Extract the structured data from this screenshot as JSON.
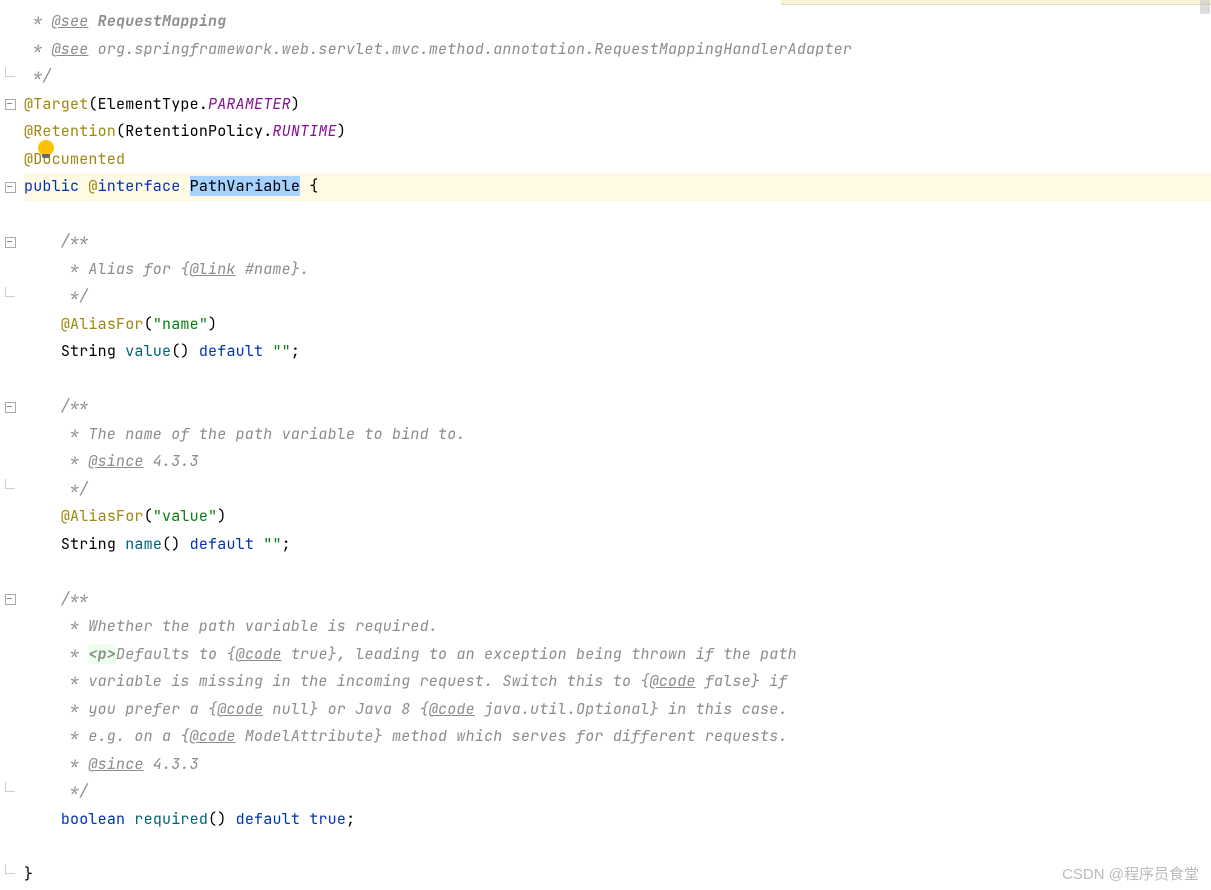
{
  "watermark": "CSDN @程序员食堂",
  "code": {
    "line1": {
      "prefix": " * ",
      "tag": "@see",
      "link": "RequestMapping"
    },
    "line2": {
      "prefix": " * ",
      "tag": "@see",
      "text": "org.springframework.web.servlet.mvc.method.annotation.RequestMappingHandlerAdapter"
    },
    "line3": {
      "text": " */"
    },
    "line4": {
      "anno": "@Target",
      "lparen": "(",
      "type": "ElementType.",
      "field": "PARAMETER",
      "rparen": ")"
    },
    "line5": {
      "anno": "@Retention",
      "lparen": "(",
      "type": "RetentionPolicy.",
      "field": "RUNTIME",
      "rparen": ")"
    },
    "line6": {
      "anno": "@Documented"
    },
    "line7": {
      "public": "public",
      "at": "@",
      "interface": "interface",
      "className": "PathVariable",
      "brace": " {"
    },
    "line8": {
      "text": ""
    },
    "line9": {
      "text": "    /**"
    },
    "line10": {
      "prefix": "     * Alias for {",
      "tag": "@link",
      "rest": " #name}."
    },
    "line11": {
      "text": "     */"
    },
    "line12": {
      "indent": "    ",
      "anno": "@AliasFor",
      "lparen": "(",
      "str": "\"name\"",
      "rparen": ")"
    },
    "line13": {
      "indent": "    ",
      "type": "String ",
      "method": "value",
      "parens": "()",
      "default": " default ",
      "str": "\"\"",
      "semi": ";"
    },
    "line14": {
      "text": ""
    },
    "line15": {
      "text": "    /**"
    },
    "line16": {
      "text": "     * The name of the path variable to bind to."
    },
    "line17": {
      "prefix": "     * ",
      "tag": "@since",
      "rest": " 4.3.3"
    },
    "line18": {
      "text": "     */"
    },
    "line19": {
      "indent": "    ",
      "anno": "@AliasFor",
      "lparen": "(",
      "str": "\"value\"",
      "rparen": ")"
    },
    "line20": {
      "indent": "    ",
      "type": "String ",
      "method": "name",
      "parens": "()",
      "default": " default ",
      "str": "\"\"",
      "semi": ";"
    },
    "line21": {
      "text": ""
    },
    "line22": {
      "text": "    /**"
    },
    "line23": {
      "text": "     * Whether the path variable is required."
    },
    "line24": {
      "prefix": "     * ",
      "ptag": "<p>",
      "rest1": "Defaults to {",
      "code": "@code",
      "rest2": " true}, leading to an exception being thrown if the path"
    },
    "line25": {
      "prefix": "     * variable is missing in the incoming request. Switch this to {",
      "code": "@code",
      "rest": " false} if"
    },
    "line26": {
      "prefix": "     * you prefer a {",
      "code1": "@code",
      "mid": " null} or Java 8 {",
      "code2": "@code",
      "rest": " java.util.Optional} in this case."
    },
    "line27": {
      "prefix": "     * e.g. on a {",
      "code": "@code",
      "rest": " ModelAttribute} method which serves for different requests."
    },
    "line28": {
      "prefix": "     * ",
      "tag": "@since",
      "rest": " 4.3.3"
    },
    "line29": {
      "text": "     */"
    },
    "line30": {
      "indent": "    ",
      "type": "boolean ",
      "method": "required",
      "parens": "()",
      "default": " default ",
      "bool": "true",
      "semi": ";"
    },
    "line31": {
      "text": ""
    },
    "line32": {
      "text": "}"
    }
  }
}
